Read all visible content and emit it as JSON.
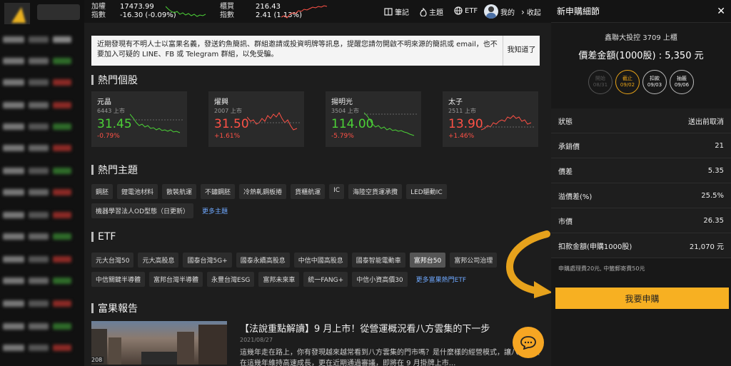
{
  "topbar": {
    "index1": {
      "name_line1": "加權",
      "name_line2": "指數",
      "value": "17473.99",
      "change": "-16.30 (-0.09%)"
    },
    "index2": {
      "name_line1": "櫃買",
      "name_line2": "指數",
      "value": "216.43",
      "change": "2.41 (1.13%)"
    },
    "menu": {
      "notes": "筆記",
      "topics": "主題",
      "etf": "ETF",
      "mine": "我的",
      "collapse": "收起"
    }
  },
  "notice": {
    "text": "近期發現有不明人士以富果名義，發送釣魚簡訊、群組邀請或投資明牌等訊息，提醒您請勿開啟不明來源的簡訊或 email，也不要加入可疑的 LINE、FB 或 Telegram 群組，以免受騙。",
    "button": "我知道了"
  },
  "hot_stocks": {
    "title": "熱門個股",
    "cards": [
      {
        "name": "元晶",
        "sub": "6443 上市",
        "price": "31.45",
        "change": "-0.79%"
      },
      {
        "name": "燿興",
        "sub": "2007 上市",
        "price": "31.50",
        "change": "+1.61%"
      },
      {
        "name": "揚明光",
        "sub": "3504 上市",
        "price": "114.00",
        "change": "-5.79%"
      },
      {
        "name": "太子",
        "sub": "2511 上市",
        "price": "13.90",
        "change": "+1.46%"
      }
    ]
  },
  "topics": {
    "title": "熱門主題",
    "chips": [
      "鋼胚",
      "鋰電池材料",
      "散裝航運",
      "不鏽鋼胚",
      "冷熱軋鋼板捲",
      "貨櫃航運",
      "IC",
      "海陸空貨運承攬",
      "LED驅動IC",
      "機器學習法人OD型態（日更新）"
    ],
    "more": "更多主題"
  },
  "etf": {
    "title": "ETF",
    "chips": [
      "元大台灣50",
      "元大高股息",
      "國泰台灣5G+",
      "國泰永續高股息",
      "中信中國高股息",
      "國泰智能電動車",
      "富邦台50",
      "富邦公司治理",
      "中信關鍵半導體",
      "富邦台灣半導體",
      "永豐台灣ESG",
      "富邦未來車",
      "統一FANG+",
      "中信小資高價30"
    ],
    "more": "更多富果熱門ETF"
  },
  "report": {
    "title": "富果報告",
    "article_title": "【法說重點解讀】9 月上市！從營運概況看八方雲集的下一步",
    "article_date": "2021/08/27",
    "article_body": "這幾年走在路上，你有發現越來越常看到八方雲集的門市嗎？是什麼樣的經營模式，讓八方雲集在這幾年維持高速成長，更在近期通過審議，即將在 9 月掛牌上市...",
    "img_label": "208"
  },
  "panel": {
    "title": "新申購細節",
    "stock": "鑫聯大投控 3709 上櫃",
    "amount": "價差金額(1000股) : 5,350 元",
    "steps": [
      {
        "label": "開始",
        "date": "08/31"
      },
      {
        "label": "截止",
        "date": "09/02"
      },
      {
        "label": "扣款",
        "date": "09/03"
      },
      {
        "label": "抽籤",
        "date": "09/06"
      }
    ],
    "rows": [
      {
        "label": "狀態",
        "value": "送出前取消"
      },
      {
        "label": "承銷價",
        "value": "21"
      },
      {
        "label": "價差",
        "value": "5.35"
      },
      {
        "label": "溢價差(%)",
        "value": "25.5%"
      },
      {
        "label": "市價",
        "value": "26.35"
      },
      {
        "label": "扣款金額(申購1000股)",
        "value": "21,070 元"
      }
    ],
    "note": "申購處理費20元, 中籤郵寄費50元",
    "button": "我要申購"
  }
}
